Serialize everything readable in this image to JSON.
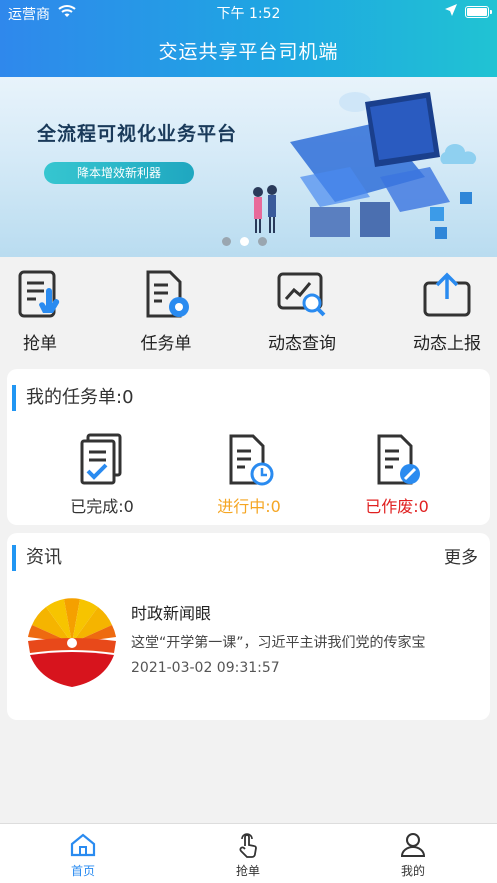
{
  "status_bar": {
    "carrier": "运营商",
    "time": "下午 1:52",
    "battery_level": 1.0
  },
  "header": {
    "title": "交运共享平台司机端"
  },
  "banner": {
    "title": "全流程可视化业务平台",
    "pill": "降本增效新利器",
    "slides": 3,
    "active_slide": 2
  },
  "quick_actions": [
    {
      "label": "抢单",
      "icon": "grab-order-icon"
    },
    {
      "label": "任务单",
      "icon": "task-settings-icon"
    },
    {
      "label": "动态查询",
      "icon": "dynamic-query-icon"
    },
    {
      "label": "动态上报",
      "icon": "upload-report-icon"
    }
  ],
  "tasks": {
    "title": "我的任务单:0",
    "items": [
      {
        "label": "已完成:0",
        "color": "#333333",
        "icon": "completed-doc-icon"
      },
      {
        "label": "进行中:0",
        "color": "#f5a623",
        "icon": "in-progress-doc-icon"
      },
      {
        "label": "已作废:0",
        "color": "#e02020",
        "icon": "void-doc-icon"
      }
    ]
  },
  "news": {
    "title": "资讯",
    "more": "更多",
    "items": [
      {
        "title": "时政新闻眼",
        "summary": "这堂“开学第一课”，习近平主讲我们党的传家宝",
        "date": "2021-03-02 09:31:57",
        "icon": "petrochina-logo"
      }
    ]
  },
  "tabbar": {
    "items": [
      {
        "label": "首页",
        "icon": "home-icon",
        "active": true
      },
      {
        "label": "抢单",
        "icon": "hand-tap-icon",
        "active": false
      },
      {
        "label": "我的",
        "icon": "user-icon",
        "active": false
      }
    ],
    "accent": "#2a8bf0"
  }
}
